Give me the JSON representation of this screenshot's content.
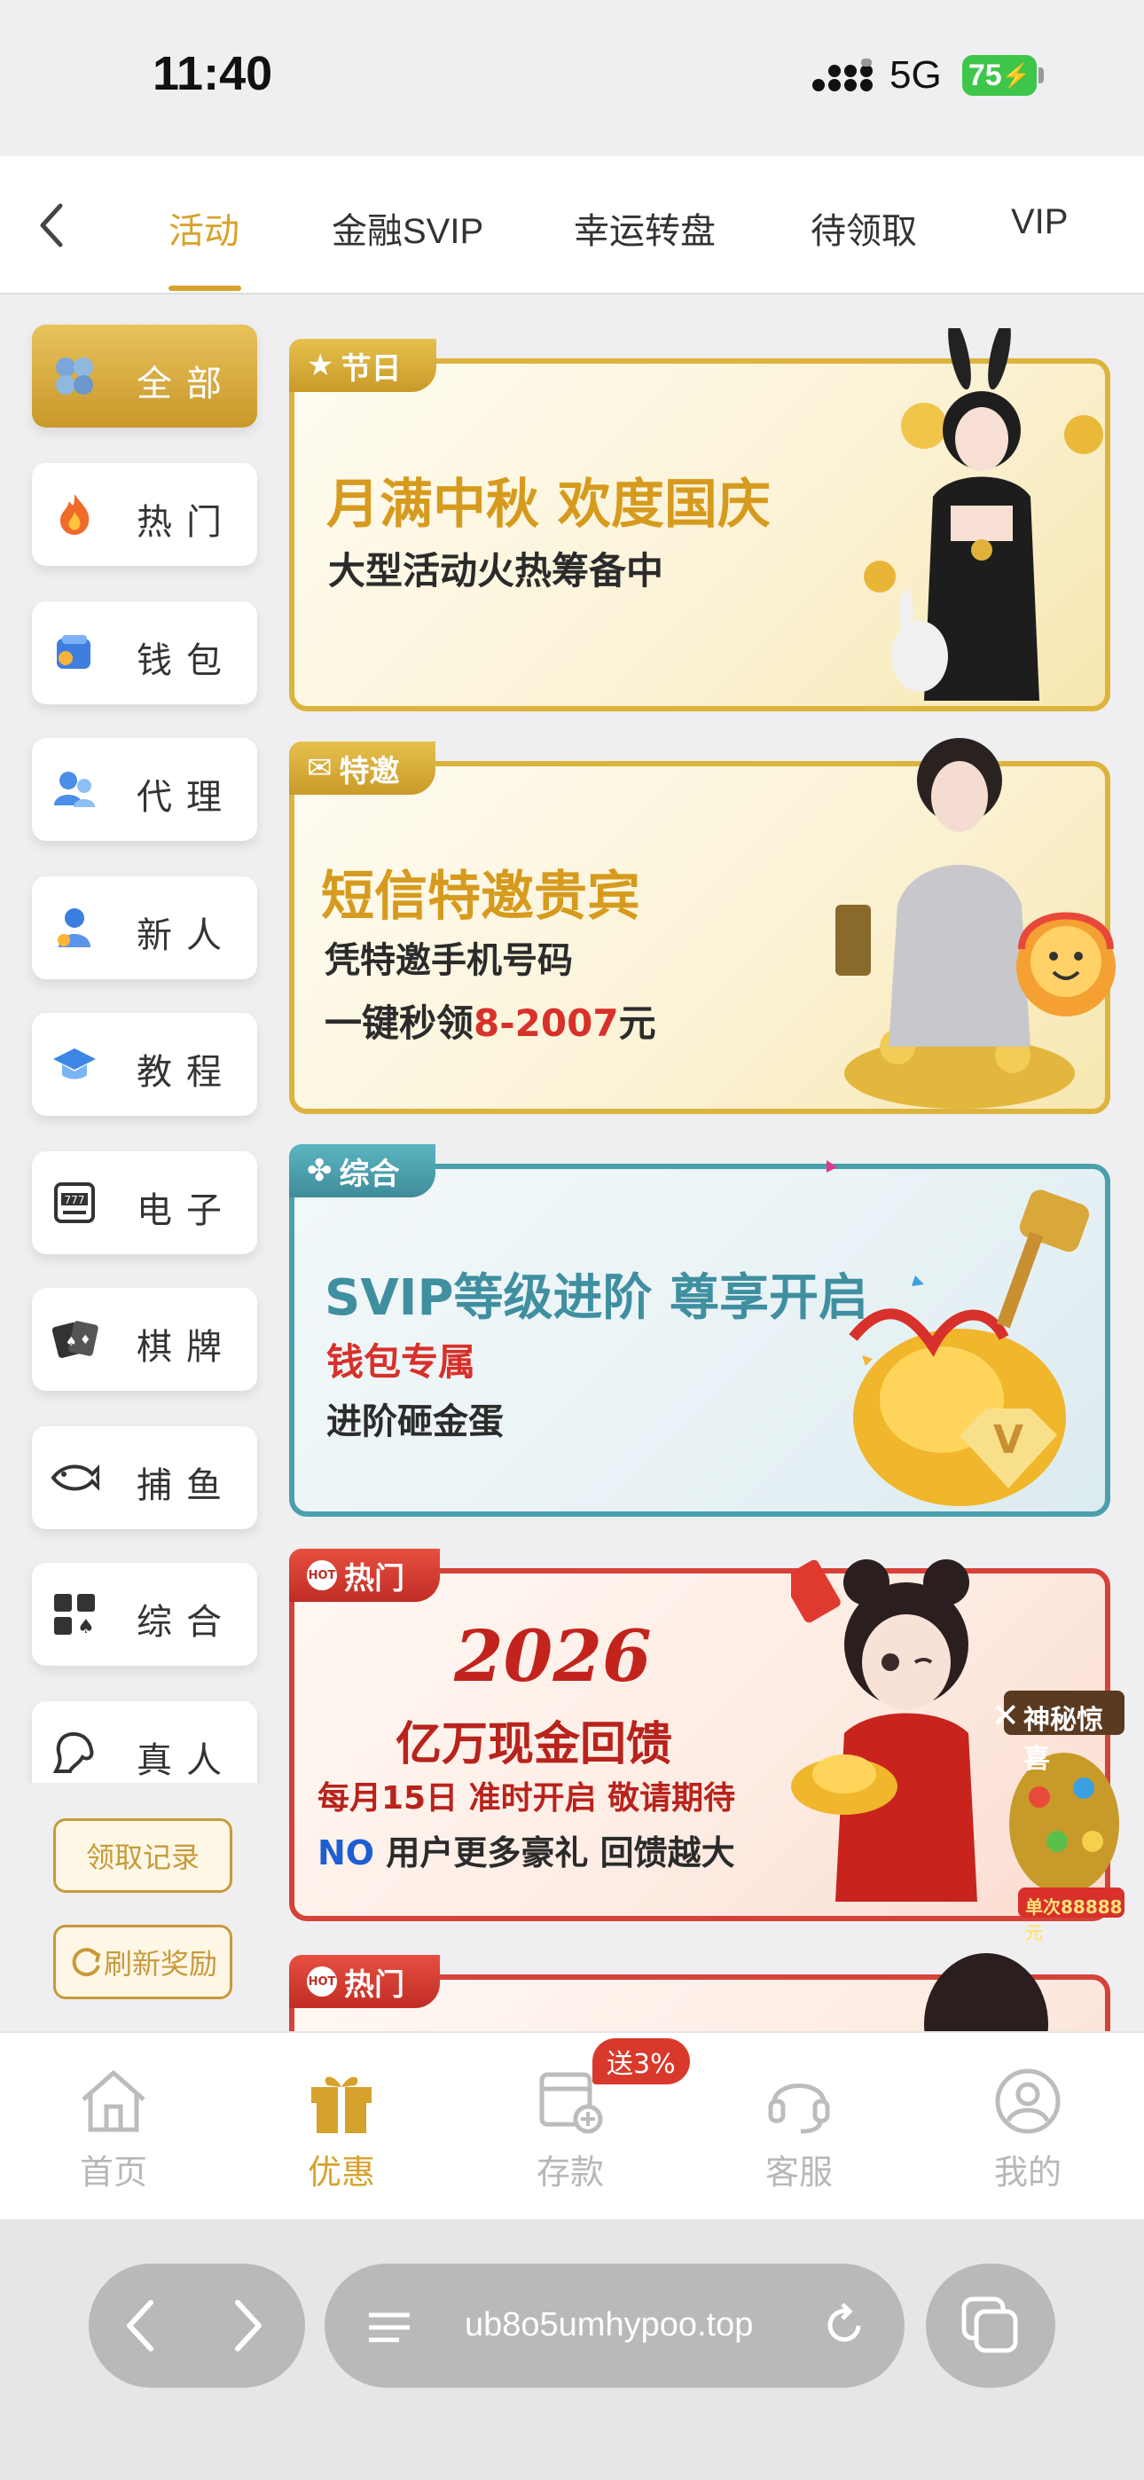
{
  "status_bar": {
    "time": "11:40",
    "network": "5G",
    "battery": "75"
  },
  "top_tabs": [
    {
      "label": "活动",
      "active": true
    },
    {
      "label": "金融SVIP",
      "active": false
    },
    {
      "label": "幸运转盘",
      "active": false
    },
    {
      "label": "待领取",
      "active": false
    },
    {
      "label": "VIP",
      "active": false
    }
  ],
  "sidebar": {
    "items": [
      {
        "label": "全部",
        "icon": "clover-icon",
        "active": true
      },
      {
        "label": "热门",
        "icon": "flame-icon",
        "active": false
      },
      {
        "label": "钱包",
        "icon": "wallet-icon",
        "active": false
      },
      {
        "label": "代理",
        "icon": "agent-icon",
        "active": false
      },
      {
        "label": "新人",
        "icon": "newbie-icon",
        "active": false
      },
      {
        "label": "教程",
        "icon": "graduation-cap-icon",
        "active": false
      },
      {
        "label": "电子",
        "icon": "slot-machine-icon",
        "active": false
      },
      {
        "label": "棋牌",
        "icon": "cards-icon",
        "active": false
      },
      {
        "label": "捕鱼",
        "icon": "fish-icon",
        "active": false
      },
      {
        "label": "综合",
        "icon": "grid-icon",
        "active": false
      },
      {
        "label": "真人",
        "icon": "live-dealer-icon",
        "active": false
      }
    ],
    "claim_record": "领取记录",
    "refresh_rewards": "刷新奖励"
  },
  "banners": [
    {
      "tag": "节日",
      "title": "月满中秋 欢度国庆",
      "subtitle": "大型活动火热筹备中"
    },
    {
      "tag": "特邀",
      "title": "短信特邀贵宾",
      "line1": "凭特邀手机号码",
      "line2_prefix": "一键秒领",
      "line2_amount": "8-2007",
      "line2_suffix": "元"
    },
    {
      "tag": "综合",
      "title": "SVIP等级进阶 尊享开启",
      "line1": "钱包专属",
      "line2": "进阶砸金蛋"
    },
    {
      "tag": "热门",
      "year": "2026",
      "title": "亿万现金回馈",
      "line1": "每月15日 准时开启 敬请期待",
      "logo": "NO",
      "line2": "用户更多豪礼 回馈越大",
      "float_title": "神秘惊喜",
      "float_amount": "单次88888元"
    },
    {
      "tag": "热门"
    }
  ],
  "bottom_nav": [
    {
      "label": "首页",
      "active": false
    },
    {
      "label": "优惠",
      "active": true
    },
    {
      "label": "存款",
      "active": false,
      "badge": "送3%"
    },
    {
      "label": "客服",
      "active": false
    },
    {
      "label": "我的",
      "active": false
    }
  ],
  "browser": {
    "url": "ub8o5umhypoo.top"
  },
  "colors": {
    "accent": "#d7a22c",
    "gold_border": "#dcb33c",
    "teal_border": "#4aa0ad",
    "red_border": "#d6423a"
  }
}
